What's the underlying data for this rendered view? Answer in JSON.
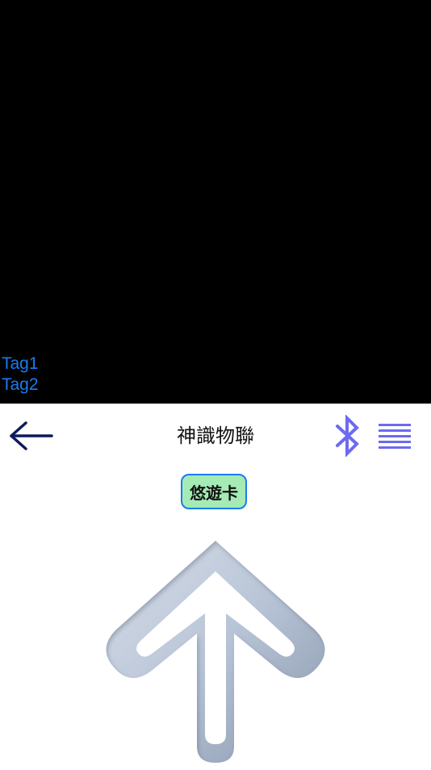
{
  "camera": {
    "tags": [
      "Tag1",
      "Tag2"
    ]
  },
  "header": {
    "title": "神識物聯",
    "back_icon": "arrow-left-icon",
    "bluetooth_icon": "bluetooth-icon",
    "menu_icon": "menu-lines-icon"
  },
  "card": {
    "label": "悠遊卡"
  },
  "direction": {
    "icon": "arrow-up-icon"
  },
  "colors": {
    "tag_text": "#1a7cf0",
    "back_arrow": "#0d1a5c",
    "bluetooth": "#6b6bf0",
    "menu": "#6b6bf0",
    "badge_fill": "#a5ebb5",
    "badge_border": "#1a7cf0",
    "arrow_fill": "#b8c4d6"
  }
}
